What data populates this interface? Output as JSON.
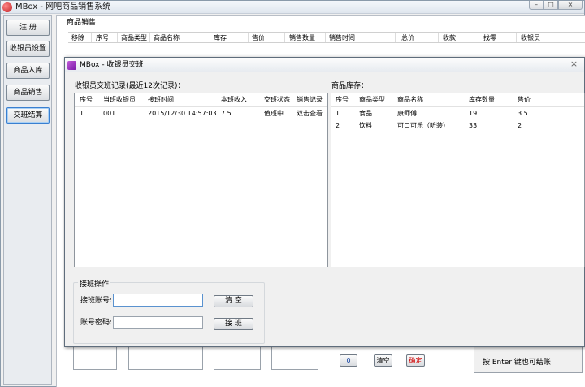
{
  "main_window": {
    "title": "MBox - 网吧商品销售系统",
    "close_label": "×",
    "min_label": "–",
    "max_label": "□"
  },
  "nav": {
    "items": [
      {
        "label": "注 册"
      },
      {
        "label": "收银员设置"
      },
      {
        "label": "商品入库"
      },
      {
        "label": "商品销售"
      },
      {
        "label": "交班结算"
      }
    ]
  },
  "sales": {
    "panel_title": "商品销售",
    "columns": [
      "移除",
      "序号",
      "商品类型",
      "商品名称",
      "库存",
      "售价",
      "销售数量",
      "销售时间",
      "总价",
      "收款",
      "找零",
      "收银员"
    ]
  },
  "bottom": {
    "count_value": "0",
    "clear_label": "清空",
    "confirm_label": "确定",
    "enter_hint": "按 Enter 键也可结账"
  },
  "dialog": {
    "title": "MBox - 收银员交班",
    "close_label": "×",
    "shift_records": {
      "label": "收银员交班记录(最近12次记录)：",
      "columns": [
        "序号",
        "当班收银员",
        "接班时间",
        "本班收入",
        "交班状态",
        "销售记录"
      ],
      "rows": [
        [
          "1",
          "001",
          "2015/12/30 14:57:03",
          "7.5",
          "值班中",
          "双击查看"
        ]
      ]
    },
    "inventory": {
      "label": "商品库存：",
      "columns": [
        "序号",
        "商品类型",
        "商品名称",
        "库存数量",
        "售价"
      ],
      "rows": [
        [
          "1",
          "食品",
          "康师傅",
          "19",
          "3.5"
        ],
        [
          "2",
          "饮料",
          "可口可乐（听装）",
          "33",
          "2"
        ]
      ]
    },
    "handover": {
      "title": "接班操作",
      "account_label": "接班账号:",
      "account_value": "",
      "password_label": "账号密码:",
      "password_value": "",
      "clear_label": "清 空",
      "handover_label": "接 班"
    }
  }
}
